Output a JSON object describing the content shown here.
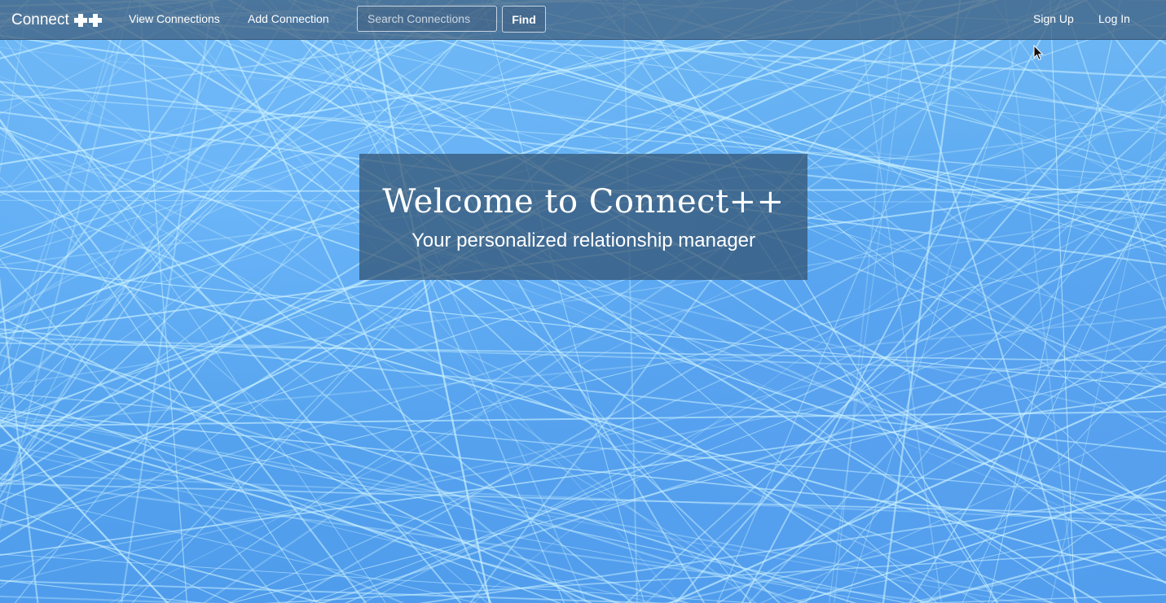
{
  "navbar": {
    "brand": "Connect",
    "brand_icon": "plus-icon",
    "links": {
      "view_connections": "View Connections",
      "add_connection": "Add Connection",
      "sign_up": "Sign Up",
      "log_in": "Log In"
    },
    "search": {
      "placeholder": "Search Connections",
      "value": ""
    },
    "find_label": "Find"
  },
  "hero": {
    "title": "Welcome to Connect++",
    "subtitle": "Your personalized relationship manager"
  },
  "colors": {
    "background": "#5aa8f0",
    "lines": "#c8f0ff",
    "navbar": "#3c5a78",
    "hero_box": "#32506e",
    "text": "#ffffff"
  }
}
